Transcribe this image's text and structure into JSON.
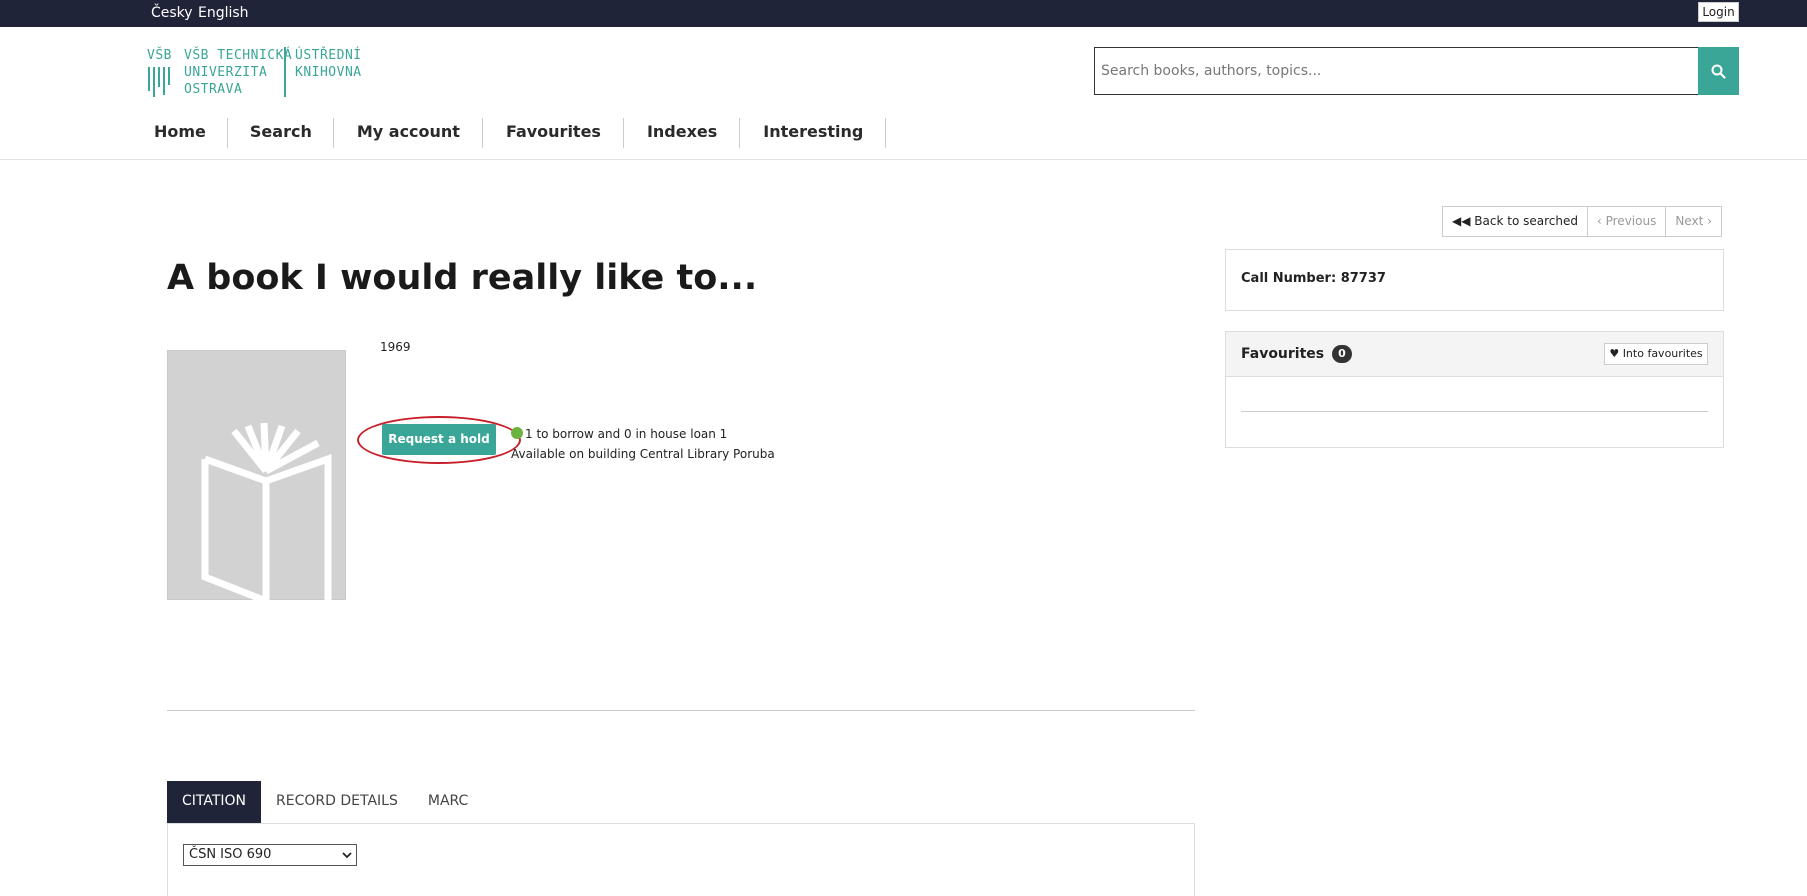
{
  "topbar": {
    "lang_cs": "Česky",
    "lang_en": "English",
    "login": "Login"
  },
  "logo": {
    "line1": "VŠB TECHNICKÁ",
    "line2": "UNIVERZITA",
    "line3": "OSTRAVA",
    "right1": "ÚSTŘEDNÍ",
    "right2": "KNIHOVNA"
  },
  "search": {
    "placeholder": "Search books, authors, topics..."
  },
  "nav": {
    "items": [
      "Home",
      "Search",
      "My account",
      "Favourites",
      "Indexes",
      "Interesting"
    ]
  },
  "pager": {
    "back": "Back to searched",
    "previous": "Previous",
    "next": "Next"
  },
  "record": {
    "title": "A book I would really like to...",
    "year": "1969",
    "hold_button": "Request a hold",
    "availability_line1": "1 to borrow and 0 in house loan 1",
    "availability_line2": "Available on building Central Library Poruba"
  },
  "sidebar": {
    "call_number": "Call Number: 87737",
    "favourites_title": "Favourites",
    "favourites_count": "0",
    "into_favourites": "Into favourites"
  },
  "tabs": {
    "items": [
      "CITATION",
      "RECORD DETAILS",
      "MARC"
    ],
    "active": "CITATION"
  },
  "citation": {
    "style_selected": "ČSN ISO 690"
  },
  "colors": {
    "topbar": "#1f2438",
    "accent": "#3aa698",
    "annotation": "#c8202a"
  }
}
